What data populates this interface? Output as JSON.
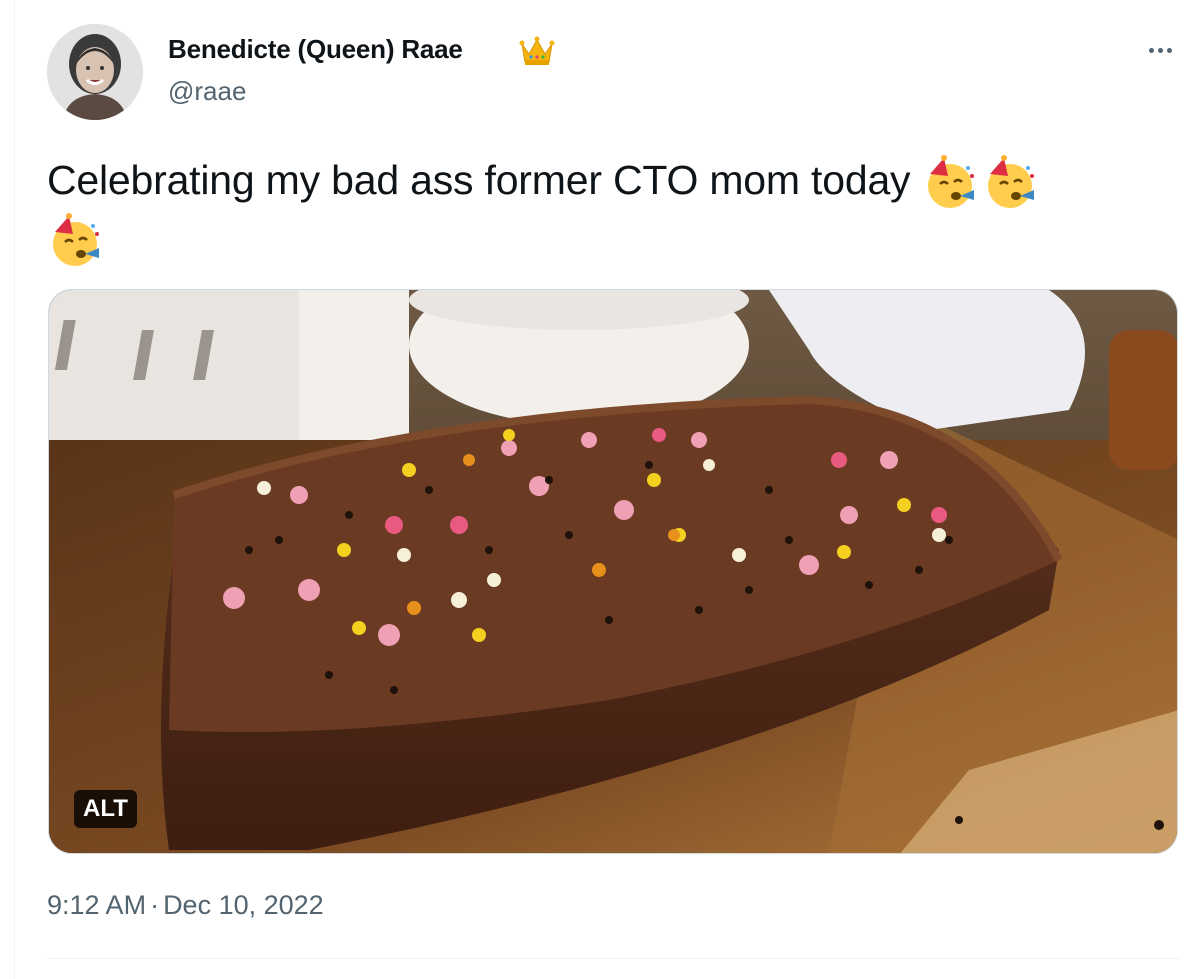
{
  "author": {
    "display_name": "Benedicte (Queen) Raae",
    "badge_icon": "crown-icon",
    "handle": "@raae",
    "avatar_icon": "profile-photo"
  },
  "tweet": {
    "text": "Celebrating my bad ass former CTO mom today",
    "emojis": [
      "partying-face-icon",
      "partying-face-icon",
      "partying-face-icon"
    ]
  },
  "media": {
    "description_icon": "chocolate-cake-photo",
    "alt_label": "ALT"
  },
  "meta": {
    "time": "9:12 AM",
    "separator": "·",
    "date": "Dec 10, 2022"
  },
  "colors": {
    "text_primary": "#0f1419",
    "text_secondary": "#536471",
    "border": "#cfd9de"
  }
}
